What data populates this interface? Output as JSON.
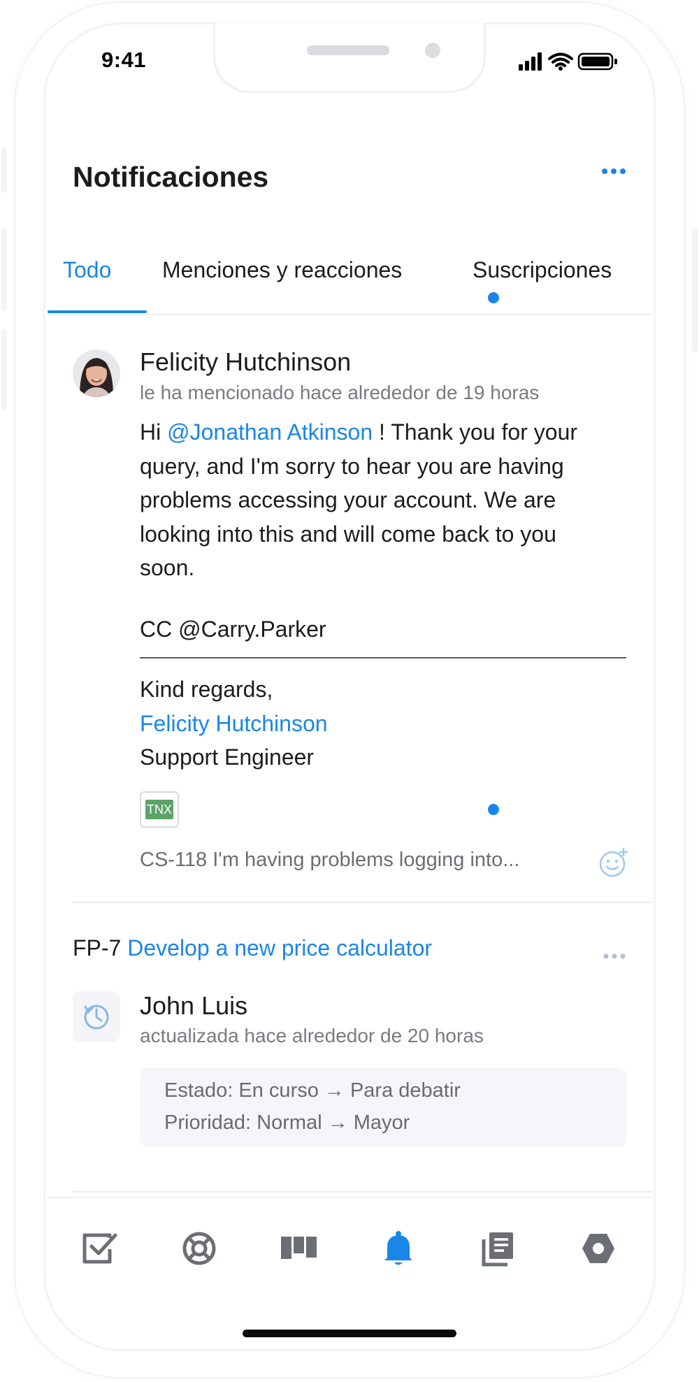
{
  "status_bar": {
    "time": "9:41"
  },
  "header": {
    "title": "Notificaciones"
  },
  "tabs": [
    {
      "label": "Todo",
      "active": true
    },
    {
      "label": "Menciones y reacciones",
      "active": false
    },
    {
      "label": "Suscripciones",
      "active": false
    }
  ],
  "notification1": {
    "author": "Felicity Hutchinson",
    "meta": "le ha mencionado hace alrededor de 19 horas",
    "unread": true,
    "body": {
      "greeting": "Hi",
      "mention": "@Jonathan Atkinson",
      "line1_rest": "! Thank you for your",
      "line2": "query, and I'm sorry to hear you are having",
      "line3": "problems accessing your account. We are",
      "line4": "looking into this and will come back to you",
      "line5": "soon.",
      "cc": "CC @Carry.Parker",
      "regards": "Kind regards,",
      "signature_name": "Felicity Hutchinson",
      "signature_role": "Support Engineer"
    },
    "attachment_label": "TNX",
    "issue_ref": "CS-118 I'm having problems logging into..."
  },
  "notification2": {
    "issue_key": "FP-7",
    "issue_title": "Develop a new price calculator",
    "author": "John Luis",
    "meta": "actualizada hace alrededor de 20 horas",
    "unread": true,
    "changes": [
      {
        "field": "Estado:",
        "value": "En curso → Para debatir"
      },
      {
        "field": "Prioridad:",
        "value": "Normal → Mayor"
      }
    ]
  },
  "bottom_nav": [
    {
      "name": "tasks-icon",
      "active": false
    },
    {
      "name": "help-icon",
      "active": false
    },
    {
      "name": "board-icon",
      "active": false
    },
    {
      "name": "bell-icon",
      "active": true
    },
    {
      "name": "pages-icon",
      "active": false
    },
    {
      "name": "hexagon-icon",
      "active": false
    }
  ],
  "colors": {
    "accent": "#1a86e8",
    "text": "#1c1c1e",
    "muted": "#7a7a80"
  }
}
